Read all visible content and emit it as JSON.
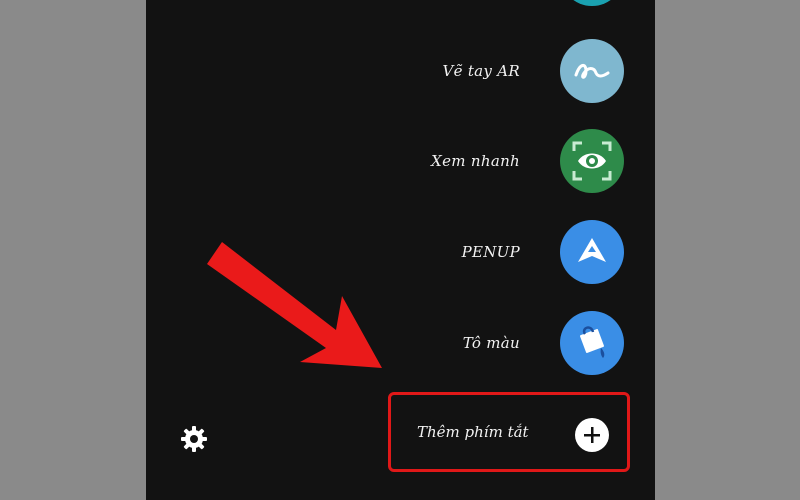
{
  "shortcuts": [
    {
      "label": "Vẽ tay AR",
      "icon": "squiggle-icon",
      "color": "#7fb7cf"
    },
    {
      "label": "Xem nhanh",
      "icon": "eye-scan-icon",
      "color": "#2e8b4a"
    },
    {
      "label": "PENUP",
      "icon": "penup-icon",
      "color": "#3a8ee6"
    },
    {
      "label": "Tô màu",
      "icon": "paint-bucket-icon",
      "color": "#3a8ee6"
    }
  ],
  "add_shortcut": {
    "label": "Thêm phím tắt",
    "icon": "plus-icon"
  },
  "settings": {
    "icon": "gear-icon"
  },
  "colors": {
    "highlight": "#e01818",
    "background": "#121212"
  }
}
